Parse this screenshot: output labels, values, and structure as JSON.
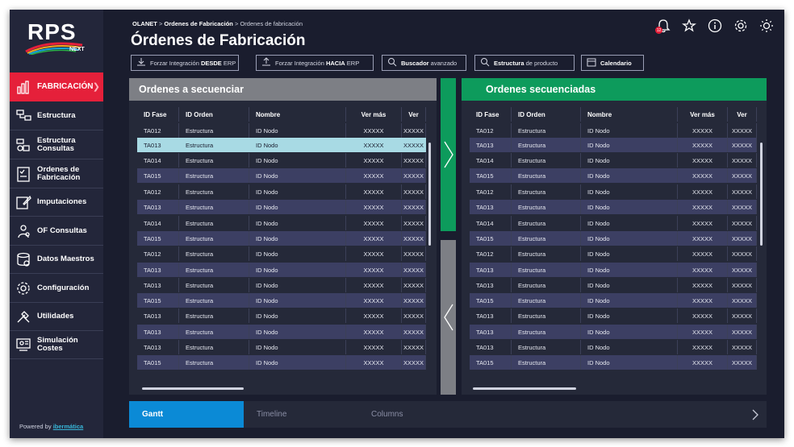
{
  "app": {
    "logo_text": "RPS",
    "logo_sub": "NEXT",
    "powered_prefix": "Powered by",
    "powered_brand": "ibermática"
  },
  "sidebar": {
    "items": [
      {
        "label": "FABRICACIÓN",
        "icon": "bar-chart-icon",
        "active": true
      },
      {
        "label": "Estructura",
        "icon": "structure-icon"
      },
      {
        "label": "Estructura\nConsultas",
        "icon": "structure-query-icon"
      },
      {
        "label": "Ordenes de\nFabricación",
        "icon": "checklist-icon"
      },
      {
        "label": "Imputaciones",
        "icon": "edit-icon"
      },
      {
        "label": "OF Consultas",
        "icon": "search-person-icon"
      },
      {
        "label": "Datos Maestros",
        "icon": "stack-gear-icon"
      },
      {
        "label": "Configuración",
        "icon": "gear-icon"
      },
      {
        "label": "Utilidades",
        "icon": "tools-icon"
      },
      {
        "label": "Simulación\nCostes",
        "icon": "cost-simulation-icon"
      }
    ]
  },
  "header": {
    "breadcrumb": {
      "root": "OLANET",
      "section": "Ordenes de Fabricación",
      "current": "Ordenes de fabricación",
      "sep": ">"
    },
    "title": "Órdenes de Fabricación",
    "notifications_count": "12",
    "icons": [
      "bell-icon",
      "star-icon",
      "info-icon",
      "gear-icon",
      "sun-icon"
    ]
  },
  "toolbar": [
    {
      "pre": "Forzar Integración",
      "bold": "DESDE",
      "post": "ERP",
      "icon": "download-icon"
    },
    {
      "pre": "Forzar Integración",
      "bold": "HACIA",
      "post": "ERP",
      "icon": "upload-icon"
    },
    {
      "pre": "",
      "bold": "Buscador",
      "post": "avanzado",
      "icon": "search-icon"
    },
    {
      "pre": "",
      "bold": "Estructura",
      "post": "de producto",
      "icon": "search-icon"
    },
    {
      "pre": "",
      "bold": "Calendario",
      "post": "",
      "icon": "calendar-icon"
    }
  ],
  "left_panel": {
    "title": "Ordenes a secuenciar",
    "header_color": "#7d7f85",
    "columns": [
      "ID Fase",
      "ID Orden",
      "Nombre",
      "Ver más",
      "Ver"
    ],
    "rows": [
      [
        "TA012",
        "Estructura",
        "ID Nodo",
        "XXXXX",
        "XXXXX"
      ],
      [
        "TA013",
        "Estructura",
        "ID Nodo",
        "XXXXX",
        "XXXXX"
      ],
      [
        "TA014",
        "Estructura",
        "ID Nodo",
        "XXXXX",
        "XXXXX"
      ],
      [
        "TA015",
        "Estructura",
        "ID Nodo",
        "XXXXX",
        "XXXXX"
      ],
      [
        "TA012",
        "Estructura",
        "ID Nodo",
        "XXXXX",
        "XXXXX"
      ],
      [
        "TA013",
        "Estructura",
        "ID Nodo",
        "XXXXX",
        "XXXXX"
      ],
      [
        "TA014",
        "Estructura",
        "ID Nodo",
        "XXXXX",
        "XXXXX"
      ],
      [
        "TA015",
        "Estructura",
        "ID Nodo",
        "XXXXX",
        "XXXXX"
      ],
      [
        "TA012",
        "Estructura",
        "ID Nodo",
        "XXXXX",
        "XXXXX"
      ],
      [
        "TA013",
        "Estructura",
        "ID Nodo",
        "XXXXX",
        "XXXXX"
      ],
      [
        "TA013",
        "Estructura",
        "ID Nodo",
        "XXXXX",
        "XXXXX"
      ],
      [
        "TA015",
        "Estructura",
        "ID Nodo",
        "XXXXX",
        "XXXXX"
      ],
      [
        "TA013",
        "Estructura",
        "ID Nodo",
        "XXXXX",
        "XXXXX"
      ],
      [
        "TA013",
        "Estructura",
        "ID Nodo",
        "XXXXX",
        "XXXXX"
      ],
      [
        "TA013",
        "Estructura",
        "ID Nodo",
        "XXXXX",
        "XXXXX"
      ],
      [
        "TA015",
        "Estructura",
        "ID Nodo",
        "XXXXX",
        "XXXXX"
      ]
    ],
    "selected_row": 1
  },
  "right_panel": {
    "title": "Ordenes secuenciadas",
    "header_color": "#0d9b5c",
    "columns": [
      "ID Fase",
      "ID Orden",
      "Nombre",
      "Ver más",
      "Ver"
    ],
    "rows": [
      [
        "TA012",
        "Estructura",
        "ID Nodo",
        "XXXXX",
        "XXXXX"
      ],
      [
        "TA013",
        "Estructura",
        "ID Nodo",
        "XXXXX",
        "XXXXX"
      ],
      [
        "TA014",
        "Estructura",
        "ID Nodo",
        "XXXXX",
        "XXXXX"
      ],
      [
        "TA015",
        "Estructura",
        "ID Nodo",
        "XXXXX",
        "XXXXX"
      ],
      [
        "TA012",
        "Estructura",
        "ID Nodo",
        "XXXXX",
        "XXXXX"
      ],
      [
        "TA013",
        "Estructura",
        "ID Nodo",
        "XXXXX",
        "XXXXX"
      ],
      [
        "TA014",
        "Estructura",
        "ID Nodo",
        "XXXXX",
        "XXXXX"
      ],
      [
        "TA015",
        "Estructura",
        "ID Nodo",
        "XXXXX",
        "XXXXX"
      ],
      [
        "TA012",
        "Estructura",
        "ID Nodo",
        "XXXXX",
        "XXXXX"
      ],
      [
        "TA013",
        "Estructura",
        "ID Nodo",
        "XXXXX",
        "XXXXX"
      ],
      [
        "TA013",
        "Estructura",
        "ID Nodo",
        "XXXXX",
        "XXXXX"
      ],
      [
        "TA015",
        "Estructura",
        "ID Nodo",
        "XXXXX",
        "XXXXX"
      ],
      [
        "TA013",
        "Estructura",
        "ID Nodo",
        "XXXXX",
        "XXXXX"
      ],
      [
        "TA013",
        "Estructura",
        "ID Nodo",
        "XXXXX",
        "XXXXX"
      ],
      [
        "TA013",
        "Estructura",
        "ID Nodo",
        "XXXXX",
        "XXXXX"
      ],
      [
        "TA015",
        "Estructura",
        "ID Nodo",
        "XXXXX",
        "XXXXX"
      ]
    ]
  },
  "transfer": {
    "right_color": "#0d9b5c",
    "left_color": "#7d7f85",
    "right_icon": "chevron-right-icon",
    "left_icon": "chevron-left-icon"
  },
  "bottom_tabs": {
    "items": [
      "Gantt",
      "Timeline",
      "Columns"
    ],
    "active": 0,
    "accent": "#0b8ad6"
  }
}
